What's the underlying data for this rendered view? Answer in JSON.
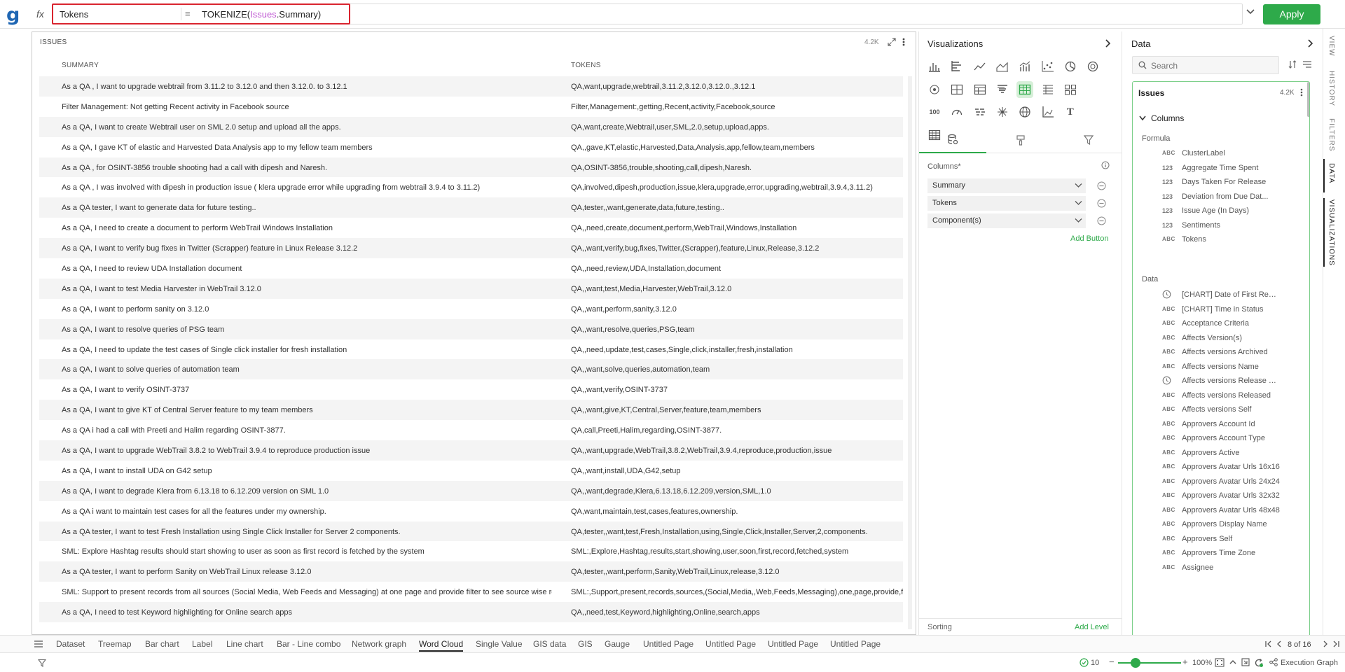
{
  "app": {
    "logo": "g",
    "fx_label": "fx"
  },
  "formula": {
    "name": "Tokens",
    "equals": "=",
    "func": "TOKENIZE(",
    "table": "Issues",
    "field": ".Summary)",
    "apply_label": "Apply"
  },
  "issues": {
    "title": "ISSUES",
    "count": "4.2K",
    "columns": [
      "SUMMARY",
      "TOKENS"
    ],
    "rows": [
      [
        "As a QA , I want to upgrade webtrail from 3.11.2 to 3.12.0 and then 3.12.0. to 3.12.1",
        "QA,want,upgrade,webtrail,3.11.2,3.12.0,3.12.0.,3.12.1"
      ],
      [
        "Filter Management: Not getting Recent activity in Facebook source",
        "Filter,Management:,getting,Recent,activity,Facebook,source"
      ],
      [
        "As a QA, I want to create Webtrail user on SML 2.0 setup and upload all the apps.",
        "QA,want,create,Webtrail,user,SML,2.0,setup,upload,apps."
      ],
      [
        "As a QA, I gave KT of elastic and Harvested Data Analysis app to my fellow team members",
        "QA,,gave,KT,elastic,Harvested,Data,Analysis,app,fellow,team,members"
      ],
      [
        "As a QA , for OSINT-3856 trouble shooting had a call with dipesh and Naresh.",
        "QA,OSINT-3856,trouble,shooting,call,dipesh,Naresh."
      ],
      [
        "As a QA , I was involved with dipesh in production issue ( klera upgrade error while upgrading from webtrail 3.9.4 to 3.11.2)",
        "QA,involved,dipesh,production,issue,klera,upgrade,error,upgrading,webtrail,3.9.4,3.11.2)"
      ],
      [
        "As a QA tester, I want to generate data for future testing..",
        "QA,tester,,want,generate,data,future,testing.."
      ],
      [
        "As a QA, I need to create a document to perform WebTrail Windows Installation",
        "QA,,need,create,document,perform,WebTrail,Windows,Installation"
      ],
      [
        "As a QA, I want to verify bug fixes in Twitter (Scrapper) feature in Linux Release 3.12.2",
        "QA,,want,verify,bug,fixes,Twitter,(Scrapper),feature,Linux,Release,3.12.2"
      ],
      [
        "As a QA, I need to review UDA Installation document",
        "QA,,need,review,UDA,Installation,document"
      ],
      [
        "As a QA, I want to test Media Harvester in WebTrail 3.12.0",
        "QA,,want,test,Media,Harvester,WebTrail,3.12.0"
      ],
      [
        "As a QA, I want to perform sanity on 3.12.0",
        "QA,,want,perform,sanity,3.12.0"
      ],
      [
        "As a QA, I want to resolve queries of PSG team",
        "QA,,want,resolve,queries,PSG,team"
      ],
      [
        "As a QA, I need to update the test cases of Single click installer for fresh installation",
        "QA,,need,update,test,cases,Single,click,installer,fresh,installation"
      ],
      [
        "As a QA, I want to solve queries of automation team",
        "QA,,want,solve,queries,automation,team"
      ],
      [
        "As a QA, I want to verify OSINT-3737",
        "QA,,want,verify,OSINT-3737"
      ],
      [
        "As a QA, I want to give KT of Central Server feature to my team members",
        "QA,,want,give,KT,Central,Server,feature,team,members"
      ],
      [
        "As a QA i had a call with Preeti and Halim regarding OSINT-3877.",
        "QA,call,Preeti,Halim,regarding,OSINT-3877."
      ],
      [
        "As a QA, I want to upgrade WebTrail 3.8.2 to WebTrail 3.9.4 to reproduce production issue",
        "QA,,want,upgrade,WebTrail,3.8.2,WebTrail,3.9.4,reproduce,production,issue"
      ],
      [
        "As a QA, I want to install UDA on G42 setup",
        "QA,,want,install,UDA,G42,setup"
      ],
      [
        "As a QA, I want to degrade Klera from 6.13.18 to 6.12.209 version on SML 1.0",
        "QA,,want,degrade,Klera,6.13.18,6.12.209,version,SML,1.0"
      ],
      [
        "As a QA i want to maintain test cases for all the features under my ownership.",
        "QA,want,maintain,test,cases,features,ownership."
      ],
      [
        "As a QA tester, I want to test Fresh Installation using Single Click Installer for Server 2 components.",
        "QA,tester,,want,test,Fresh,Installation,using,Single,Click,Installer,Server,2,components."
      ],
      [
        "SML: Explore Hashtag results should start showing to user as soon as first record is fetched by the system",
        "SML:,Explore,Hashtag,results,start,showing,user,soon,first,record,fetched,system"
      ],
      [
        "As a QA tester, I want to perform Sanity on WebTrail Linux release 3.12.0",
        "QA,tester,,want,perform,Sanity,WebTrail,Linux,release,3.12.0"
      ],
      [
        "SML: Support to present records from all sources (Social Media, Web Feeds and Messaging) at one page and provide filter to see source wise records",
        "SML:,Support,present,records,sources,(Social,Media,,Web,Feeds,Messaging),one,page,provide,filter,see,source,wise,records"
      ],
      [
        "As a QA, I need to test Keyword highlighting for Online search apps",
        "QA,,need,test,Keyword,highlighting,Online,search,apps"
      ]
    ]
  },
  "visualizations": {
    "title": "Visualizations",
    "columns_label": "Columns*",
    "columns": [
      "Summary",
      "Tokens",
      "Component(s)"
    ],
    "add_button": "Add Button",
    "sorting_label": "Sorting",
    "add_level": "Add Level",
    "icons": [
      "column-chart",
      "bar-chart",
      "line-chart",
      "area-chart",
      "combo-chart",
      "scatter-chart",
      "pie-chart",
      "donut-chart",
      "network-chart",
      "treemap-chart",
      "table-chart",
      "funnel-chart",
      "grid-table",
      "pivot-table",
      "tile-chart",
      "single-value",
      "gauge-chart",
      "word-cloud",
      "graph-chart",
      "globe-map",
      "histogram-chart",
      "text-label",
      "crosstab-chart"
    ],
    "icon_100": "100",
    "icon_text": "T"
  },
  "data_panel": {
    "title": "Data",
    "search_placeholder": "Search",
    "dataset": "Issues",
    "dataset_count": "4.2K",
    "columns_group": "Columns",
    "formula_label": "Formula",
    "formula_fields": [
      {
        "type": "ABC",
        "name": "ClusterLabel"
      },
      {
        "type": "123",
        "name": "Aggregate Time Spent"
      },
      {
        "type": "123",
        "name": "Days Taken For Release"
      },
      {
        "type": "123",
        "name": "Deviation from Due Dat..."
      },
      {
        "type": "123",
        "name": "Issue Age (In Days)"
      },
      {
        "type": "123",
        "name": "Sentiments"
      },
      {
        "type": "ABC",
        "name": "Tokens"
      }
    ],
    "data_label": "Data",
    "data_fields": [
      {
        "type": "clock",
        "name": "[CHART] Date of First Respo..."
      },
      {
        "type": "ABC",
        "name": "[CHART] Time in Status"
      },
      {
        "type": "ABC",
        "name": "Acceptance Criteria"
      },
      {
        "type": "ABC",
        "name": "Affects Version(s)"
      },
      {
        "type": "ABC",
        "name": "Affects versions Archived"
      },
      {
        "type": "ABC",
        "name": "Affects versions Name"
      },
      {
        "type": "clock",
        "name": "Affects versions Release Date"
      },
      {
        "type": "ABC",
        "name": "Affects versions Released"
      },
      {
        "type": "ABC",
        "name": "Affects versions Self"
      },
      {
        "type": "ABC",
        "name": "Approvers Account Id"
      },
      {
        "type": "ABC",
        "name": "Approvers Account Type"
      },
      {
        "type": "ABC",
        "name": "Approvers Active"
      },
      {
        "type": "ABC",
        "name": "Approvers Avatar Urls 16x16"
      },
      {
        "type": "ABC",
        "name": "Approvers Avatar Urls 24x24"
      },
      {
        "type": "ABC",
        "name": "Approvers Avatar Urls 32x32"
      },
      {
        "type": "ABC",
        "name": "Approvers Avatar Urls 48x48"
      },
      {
        "type": "ABC",
        "name": "Approvers Display Name"
      },
      {
        "type": "ABC",
        "name": "Approvers Self"
      },
      {
        "type": "ABC",
        "name": "Approvers Time Zone"
      },
      {
        "type": "ABC",
        "name": "Assignee"
      }
    ]
  },
  "rail": {
    "tabs": [
      "VIEW",
      "HISTORY",
      "FILTERS",
      "DATA",
      "VISUALIZATIONS"
    ]
  },
  "pages": {
    "tabs": [
      "Dataset",
      "Treemap",
      "Bar chart",
      "Label",
      "Line chart",
      "Bar - Line combo",
      "Network graph",
      "Word Cloud",
      "Single Value",
      "GIS data",
      "GIS",
      "Gauge",
      "Untitled Page",
      "Untitled Page",
      "Untitled Page",
      "Untitled Page"
    ],
    "active": "Word Cloud",
    "page_info": "8 of 16"
  },
  "status": {
    "count": "10",
    "zoom_level": 0.28,
    "zoom": "100%",
    "exec_graph": "Execution Graph"
  },
  "colors": {
    "accent": "#2eaa4a",
    "highlight_border": "#d9242f",
    "table_ref": "#c05bd3",
    "brand": "#1f66b3"
  }
}
